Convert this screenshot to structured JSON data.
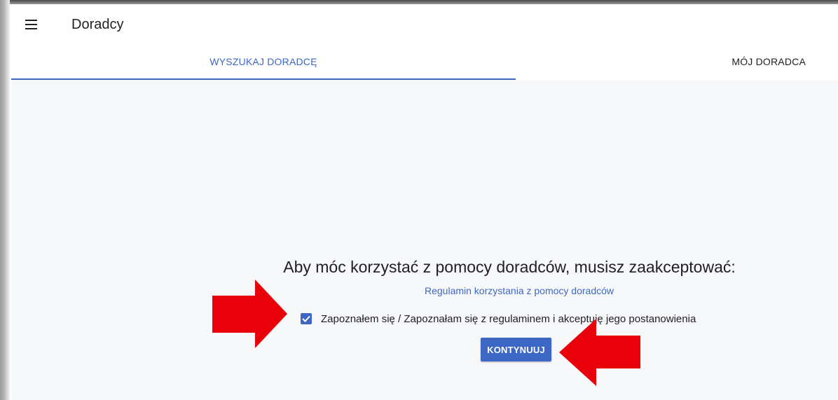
{
  "app": {
    "title": "Doradcy"
  },
  "tabs": [
    {
      "label": "WYSZUKAJ DORADCĘ",
      "active": true
    },
    {
      "label": "MÓJ DORADCA",
      "active": false
    }
  ],
  "terms": {
    "heading": "Aby móc korzystać z pomocy doradców, musisz zaakceptować:",
    "link_label": "Regulamin korzystania z pomocy doradców",
    "consent_label": "Zapoznałem się / Zapoznałam się z regulaminem i akceptuję jego postanowienia",
    "consent_checked": true,
    "continue_label": "KONTYNUUJ"
  },
  "colors": {
    "accent": "#3d67c4",
    "arrow": "#e8000b",
    "background": "#f7f8fa"
  },
  "icons": {
    "menu": "menu-icon",
    "check": "check-icon",
    "annotation_arrows": "arrow-icon"
  }
}
